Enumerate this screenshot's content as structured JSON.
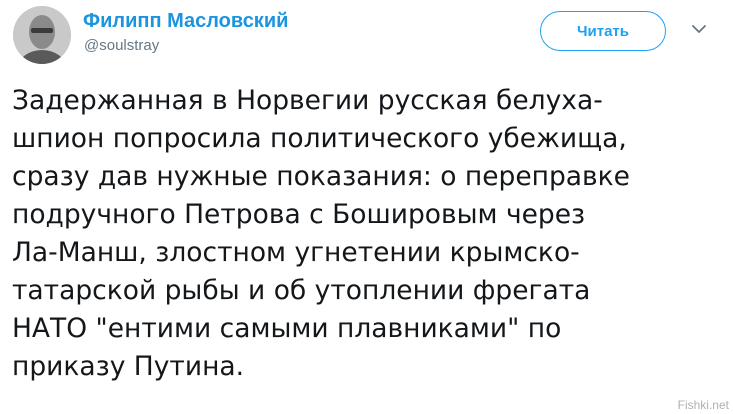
{
  "author": {
    "display_name": "Филипп Масловский",
    "username": "@soulstray"
  },
  "follow_button": {
    "label": "Читать"
  },
  "menu": {
    "icon": "chevron-down-icon"
  },
  "tweet": {
    "text": "Задержанная в Норвегии русская белуха-\nшпион попросила политического убежища,\nсразу дав нужные показания: о переправке\nподручного Петрова с Бошировым через\nЛа-Манш, злостном угнетении крымско-\nтатарской рыбы и об утоплении фрегата\nНАТО \"ентими самыми плавниками\" по\nприказу Путина."
  },
  "watermark": {
    "text": "Fishki.net"
  },
  "colors": {
    "accent": "#1da1f2",
    "name": "#1b95e0",
    "text": "#14171a",
    "secondary": "#657786"
  }
}
